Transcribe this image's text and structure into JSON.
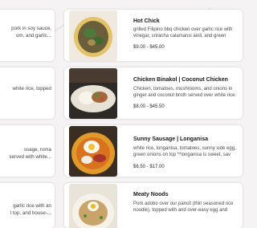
{
  "menu": {
    "items": [
      {
        "left_snippet": "pork in soy sauce,\nom, and garlic...",
        "name": "Hot Chick",
        "description": "grilled Filipino bbq chicken over garlic rice with vinegar, sriracha calamansi aioli, and green onions",
        "price": "$9.00 - $45.00",
        "image_icon": "bowl-with-greens-icon"
      },
      {
        "left_snippet": "white rice, topped",
        "name": "Chicken Binakol | Coconut Chicken",
        "description": "Chicken, tomatoes, mushrooms, and onions in ginger and coconut broth served over white rice.",
        "price": "$8.00 - $45.50",
        "image_icon": "plated-rice-icon"
      },
      {
        "left_snippet": "ssage, roma\nserved with white...",
        "name": "Sunny Sausage | Longanisa",
        "description": "white rice, longanisa, tomatoes, sunny side egg, green onions on top **longanisa is sweet, sav",
        "price": "$6.50 - $17.00",
        "image_icon": "egg-plate-icon"
      },
      {
        "left_snippet": "garlic rice with an\nl top, and house-...",
        "name": "Meaty Noods",
        "description": "Pork adobo over our pancit (thin seasoned rice noodle), topped with and over-easy egg and",
        "price": "",
        "image_icon": "noodle-plate-icon"
      }
    ]
  },
  "colors": {
    "background": "#f5f3f3",
    "card": "#ffffff",
    "title": "#1a1a1a",
    "text": "#4a4a4a"
  }
}
